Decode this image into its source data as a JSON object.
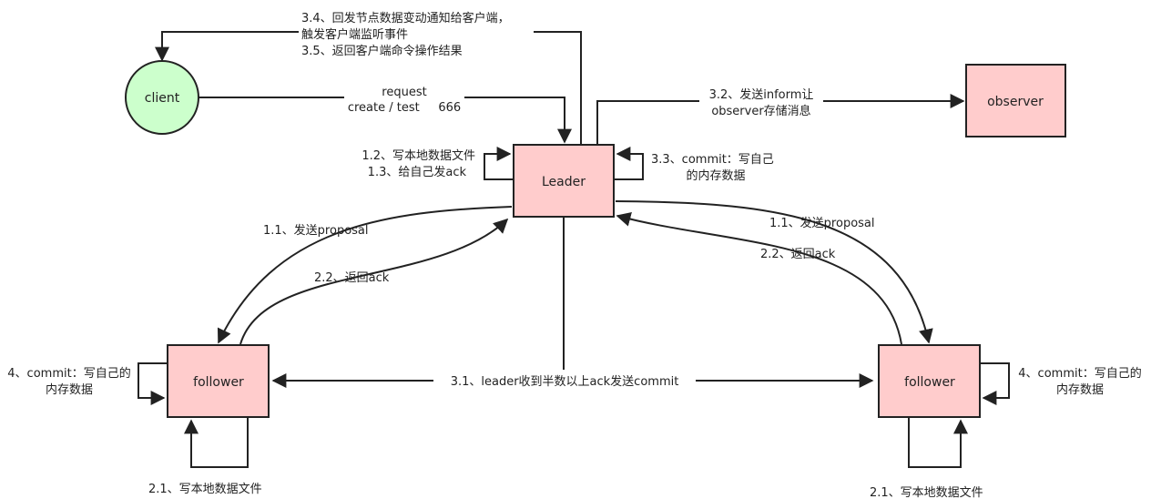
{
  "nodes": {
    "client": "client",
    "leader": "Leader",
    "observer": "observer",
    "follower_left": "follower",
    "follower_right": "follower"
  },
  "labels": {
    "notify_line1": "3.4、回发节点数据变动通知给客户端，",
    "notify_line2": "触发客户端监听事件",
    "notify_line3": "3.5、返回客户端命令操作结果",
    "request_line1": "request",
    "request_line2": "create / test     666",
    "inform_line1": "3.2、发送inform让",
    "inform_line2": "observer存储消息",
    "leader_write_line1": "1.2、写本地数据文件",
    "leader_write_line2": "1.3、给自己发ack",
    "leader_commit_line1": "3.3、commit：写自己",
    "leader_commit_line2": "的内存数据",
    "proposal_left": "1.1、发送proposal",
    "proposal_right": "1.1、发送proposal",
    "ack_left": "2.2、返回ack",
    "ack_right": "2.2、返回ack",
    "commit_broadcast": "3.1、leader收到半数以上ack发送commit",
    "commit_left_line1": "4、commit：写自己的",
    "commit_left_line2": "内存数据",
    "commit_right_line1": "4、commit：写自己的",
    "commit_right_line2": "内存数据",
    "write_left": "2.1、写本地数据文件",
    "write_right": "2.1、写本地数据文件"
  },
  "colors": {
    "box_fill": "#ffcccc",
    "client_fill": "#ccffcc",
    "stroke": "#222222"
  }
}
